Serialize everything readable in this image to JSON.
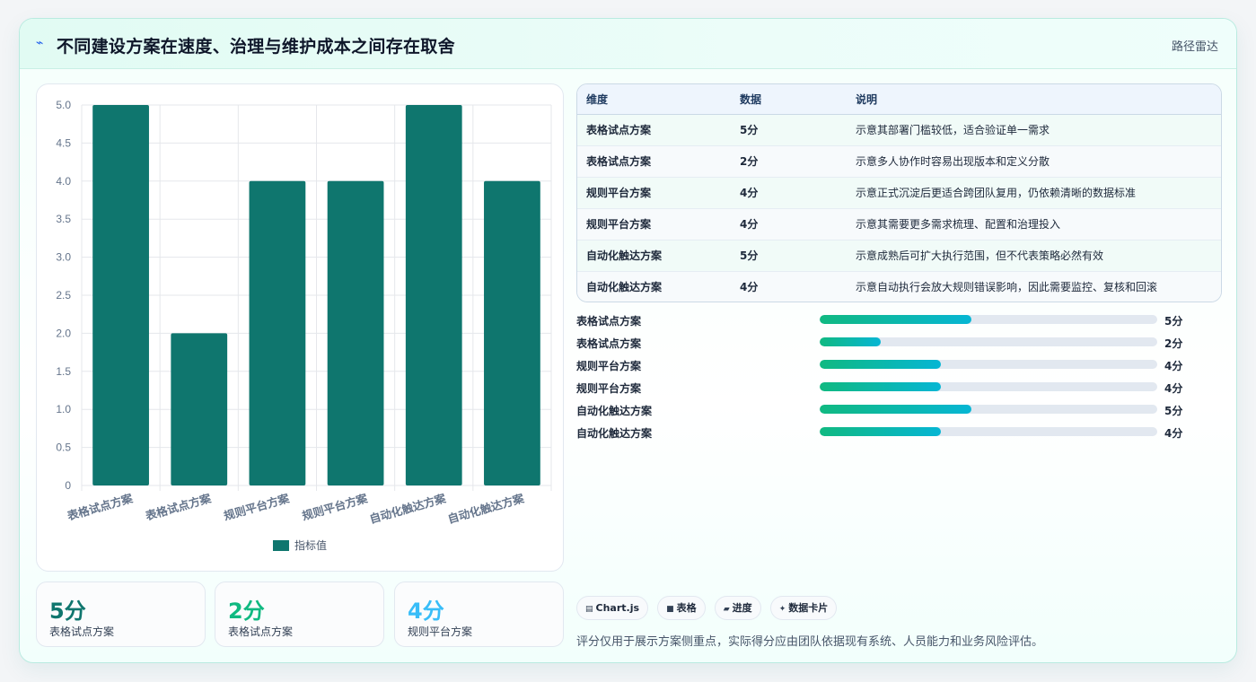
{
  "header": {
    "icon": "bolt-icon",
    "title": "不同建设方案在速度、治理与维护成本之间存在取舍",
    "tag": "路径雷达"
  },
  "chart_data": {
    "type": "bar",
    "categories": [
      "表格试点方案",
      "表格试点方案",
      "规则平台方案",
      "规则平台方案",
      "自动化触达方案",
      "自动化触达方案"
    ],
    "series": [
      {
        "name": "指标值",
        "values": [
          5,
          2,
          4,
          4,
          5,
          4
        ]
      }
    ],
    "ylim": [
      0,
      5
    ],
    "yticks": [
      "5.0",
      "4.5",
      "4.0",
      "3.5",
      "3.0",
      "2.5",
      "2.0",
      "1.5",
      "1.0",
      "0.5",
      "0"
    ],
    "grid": true,
    "legend": "bottom",
    "color": "#0f766e"
  },
  "kpis": [
    {
      "value": "5分",
      "label": "表格试点方案",
      "color": "#0f766e"
    },
    {
      "value": "2分",
      "label": "表格试点方案",
      "color": "#10b981"
    },
    {
      "value": "4分",
      "label": "规则平台方案",
      "color": "#38bdf8"
    }
  ],
  "table": {
    "headers": [
      "维度",
      "数据",
      "说明"
    ],
    "rows": [
      [
        "表格试点方案",
        "5分",
        "示意其部署门槛较低，适合验证单一需求"
      ],
      [
        "表格试点方案",
        "2分",
        "示意多人协作时容易出现版本和定义分散"
      ],
      [
        "规则平台方案",
        "4分",
        "示意正式沉淀后更适合跨团队复用，仍依赖清晰的数据标准"
      ],
      [
        "规则平台方案",
        "4分",
        "示意其需要更多需求梳理、配置和治理投入"
      ],
      [
        "自动化触达方案",
        "5分",
        "示意成熟后可扩大执行范围，但不代表策略必然有效"
      ],
      [
        "自动化触达方案",
        "4分",
        "示意自动执行会放大规则错误影响，因此需要监控、复核和回滚"
      ]
    ]
  },
  "progress": [
    {
      "label": "表格试点方案",
      "fraction": 0.45,
      "score": "5分"
    },
    {
      "label": "表格试点方案",
      "fraction": 0.18,
      "score": "2分"
    },
    {
      "label": "规则平台方案",
      "fraction": 0.36,
      "score": "4分"
    },
    {
      "label": "规则平台方案",
      "fraction": 0.36,
      "score": "4分"
    },
    {
      "label": "自动化触达方案",
      "fraction": 0.45,
      "score": "5分"
    },
    {
      "label": "自动化触达方案",
      "fraction": 0.36,
      "score": "4分"
    }
  ],
  "chips": [
    {
      "icon": "chart-icon",
      "glyph": "▤",
      "label": "Chart.js"
    },
    {
      "icon": "table-icon",
      "glyph": "■",
      "label": "表格"
    },
    {
      "icon": "progress-icon",
      "glyph": "▰",
      "label": "进度"
    },
    {
      "icon": "sparkle-icon",
      "glyph": "✦",
      "label": "数据卡片"
    }
  ],
  "footnote": "评分仅用于展示方案侧重点，实际得分应由团队依据现有系统、人员能力和业务风险评估。"
}
